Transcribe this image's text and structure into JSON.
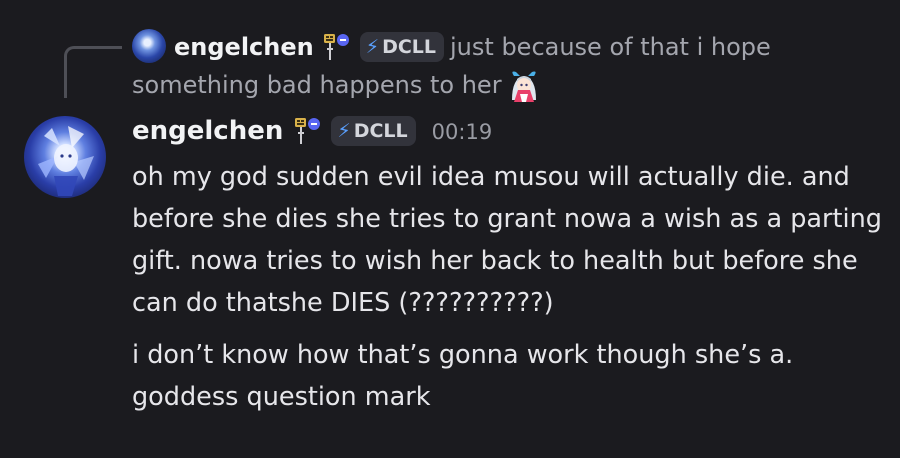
{
  "reply": {
    "username": "engelchen",
    "tag": "DCLL",
    "text": "just because of that i hope something bad happens to her"
  },
  "message": {
    "username": "engelchen",
    "tag": "DCLL",
    "timestamp": "00:19",
    "paragraphs": [
      "oh my god sudden evil idea musou will actually die. and before she dies she tries to grant nowa a wish as a parting gift. nowa tries to wish her back to health but before she can do thatshe DIES (??????????)",
      "i don’t know how that’s gonna work though she’s a. goddess question mark"
    ]
  },
  "icons": {
    "tag_icon": "lightning-bolt-icon",
    "role_icon": "traffic-sign-icon",
    "reply_emoji": "anime-girl-emoji"
  },
  "colors": {
    "background": "#1b1b1f",
    "username": "#f2f3f5",
    "message_text": "#e6e6ea",
    "reply_text": "#a4a6ae",
    "timestamp": "#9a9ca4",
    "tag_bg": "#32333b",
    "bolt": "#5aa0ff"
  }
}
